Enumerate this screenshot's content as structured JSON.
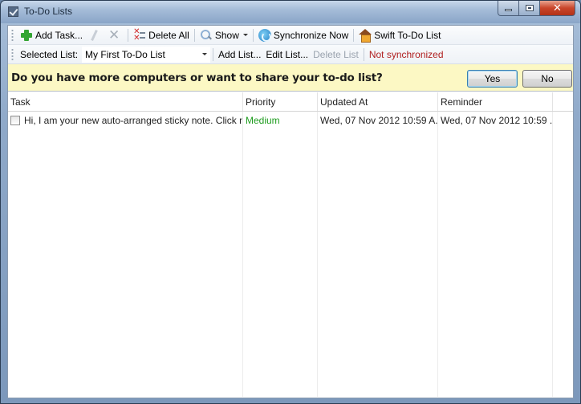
{
  "window": {
    "title": "To-Do Lists",
    "controls": {
      "minimize": "minimize",
      "maximize": "maximize",
      "close": "close"
    }
  },
  "toolbar": {
    "add_task": "Add Task...",
    "delete_all": "Delete All",
    "show": "Show",
    "synchronize_now": "Synchronize Now",
    "swift_todo_list": "Swift To-Do List"
  },
  "listbar": {
    "selected_list_label": "Selected List:",
    "selected_list_value": "My First To-Do List",
    "add_list": "Add List...",
    "edit_list": "Edit List...",
    "delete_list": "Delete List",
    "sync_status": "Not synchronized"
  },
  "banner": {
    "message": "Do you have more computers or want to share your to-do list?",
    "yes": "Yes",
    "no": "No"
  },
  "grid": {
    "columns": [
      "Task",
      "Priority",
      "Updated At",
      "Reminder"
    ],
    "rows": [
      {
        "checked": false,
        "task": "Hi, I am your new auto-arranged sticky note. Click me t...",
        "priority": "Medium",
        "updated_at": "Wed, 07 Nov 2012 10:59 A...",
        "reminder": "Wed, 07 Nov 2012 10:59 ..."
      }
    ]
  },
  "colors": {
    "priority_medium": "#1e9c1e",
    "not_synchronized": "#b02020",
    "banner_bg": "#fcf8c4"
  }
}
